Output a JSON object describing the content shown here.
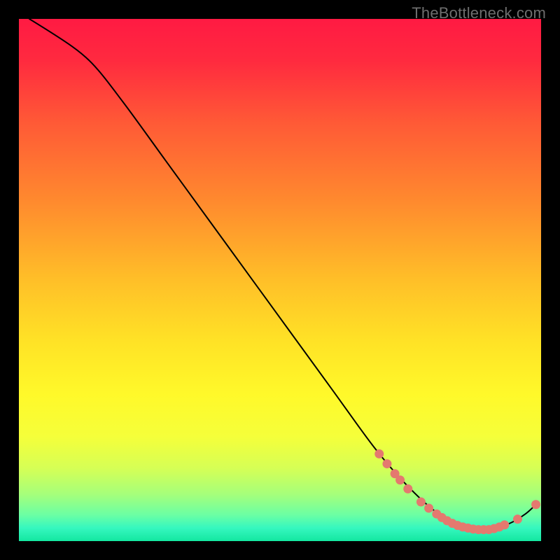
{
  "watermark": "TheBottleneck.com",
  "chart_data": {
    "type": "line",
    "title": "",
    "xlabel": "",
    "ylabel": "",
    "xlim": [
      0,
      100
    ],
    "ylim": [
      0,
      100
    ],
    "gradient_stops": [
      {
        "offset": 0.0,
        "color": "#ff1a43"
      },
      {
        "offset": 0.08,
        "color": "#ff2a3f"
      },
      {
        "offset": 0.2,
        "color": "#ff5a36"
      },
      {
        "offset": 0.35,
        "color": "#ff8a2e"
      },
      {
        "offset": 0.5,
        "color": "#ffbf28"
      },
      {
        "offset": 0.62,
        "color": "#ffe326"
      },
      {
        "offset": 0.72,
        "color": "#fff92a"
      },
      {
        "offset": 0.8,
        "color": "#f5ff3a"
      },
      {
        "offset": 0.86,
        "color": "#d6ff55"
      },
      {
        "offset": 0.91,
        "color": "#a6ff7a"
      },
      {
        "offset": 0.95,
        "color": "#6bffa4"
      },
      {
        "offset": 0.975,
        "color": "#35f7bf"
      },
      {
        "offset": 1.0,
        "color": "#14e7a0"
      }
    ],
    "curve": [
      {
        "x": 2.0,
        "y": 100.0
      },
      {
        "x": 8.0,
        "y": 96.5
      },
      {
        "x": 14.0,
        "y": 91.5
      },
      {
        "x": 20.0,
        "y": 84.0
      },
      {
        "x": 28.0,
        "y": 73.0
      },
      {
        "x": 36.0,
        "y": 62.0
      },
      {
        "x": 44.0,
        "y": 51.0
      },
      {
        "x": 52.0,
        "y": 40.0
      },
      {
        "x": 60.0,
        "y": 29.0
      },
      {
        "x": 68.0,
        "y": 18.0
      },
      {
        "x": 74.0,
        "y": 11.0
      },
      {
        "x": 80.0,
        "y": 5.5
      },
      {
        "x": 86.0,
        "y": 2.5
      },
      {
        "x": 90.0,
        "y": 2.2
      },
      {
        "x": 94.0,
        "y": 3.4
      },
      {
        "x": 97.0,
        "y": 5.2
      },
      {
        "x": 99.0,
        "y": 7.0
      }
    ],
    "curve_color": "#000000",
    "curve_width": 2,
    "markers": [
      {
        "x": 69.0,
        "y": 16.7
      },
      {
        "x": 70.5,
        "y": 14.8
      },
      {
        "x": 72.0,
        "y": 12.9
      },
      {
        "x": 73.0,
        "y": 11.7
      },
      {
        "x": 74.5,
        "y": 10.0
      },
      {
        "x": 77.0,
        "y": 7.5
      },
      {
        "x": 78.5,
        "y": 6.3
      },
      {
        "x": 80.0,
        "y": 5.2
      },
      {
        "x": 81.0,
        "y": 4.5
      },
      {
        "x": 82.0,
        "y": 3.9
      },
      {
        "x": 83.0,
        "y": 3.4
      },
      {
        "x": 84.0,
        "y": 3.0
      },
      {
        "x": 85.0,
        "y": 2.7
      },
      {
        "x": 86.0,
        "y": 2.5
      },
      {
        "x": 87.0,
        "y": 2.3
      },
      {
        "x": 88.0,
        "y": 2.2
      },
      {
        "x": 89.0,
        "y": 2.2
      },
      {
        "x": 90.0,
        "y": 2.2
      },
      {
        "x": 91.0,
        "y": 2.4
      },
      {
        "x": 92.0,
        "y": 2.7
      },
      {
        "x": 93.0,
        "y": 3.1
      },
      {
        "x": 95.5,
        "y": 4.2
      },
      {
        "x": 99.0,
        "y": 7.0
      }
    ],
    "marker_color": "#e4796f",
    "marker_radius": 6.5
  }
}
